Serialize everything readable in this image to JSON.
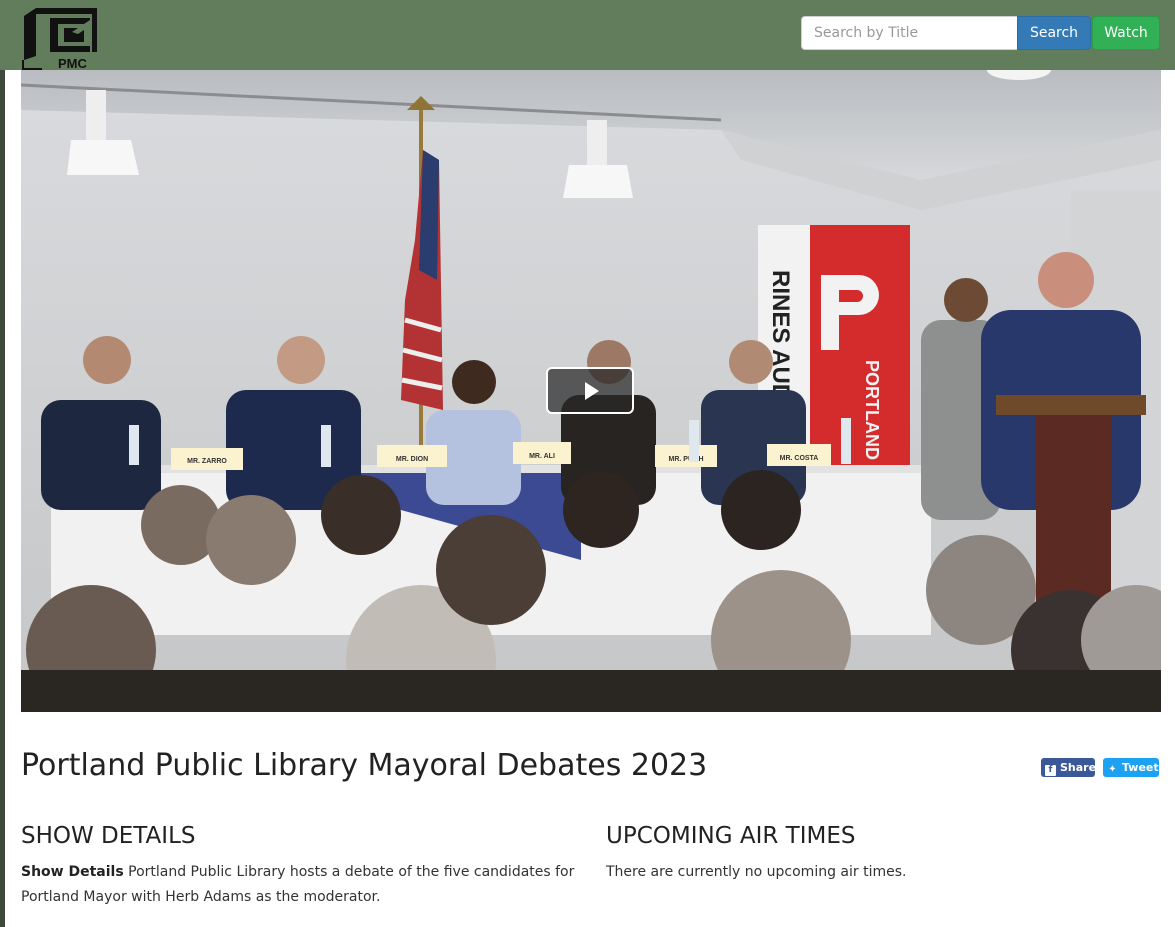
{
  "header": {
    "logo_text": "PMC",
    "search_placeholder": "Search by Title",
    "search_value": "",
    "search_button": "Search",
    "watch_button": "Watch"
  },
  "video": {
    "banner_vertical_text": "RINES AUD",
    "banner_library_text": "PORTLAND PUBLIC LIBRARY",
    "name_cards": [
      "MR. ZARRO",
      "MR. DION",
      "MR. ALI",
      "MR. PUGH",
      "MR. COSTA"
    ]
  },
  "show": {
    "title": "Portland Public Library Mayoral Debates 2023",
    "share_label": "Share",
    "tweet_label": "Tweet"
  },
  "details": {
    "heading": "SHOW DETAILS",
    "label": "Show Details",
    "description": "Portland Public Library hosts a debate of the five candidates for Portland Mayor with Herb Adams as the moderator."
  },
  "air_times": {
    "heading": "UPCOMING AIR TIMES",
    "message": "There are currently no upcoming air times."
  },
  "colors": {
    "header_bg": "#627d5b",
    "search_button": "#337ab7",
    "watch_button": "#31b055",
    "share_button": "#3b5998",
    "tweet_button": "#1da1f2"
  },
  "icons": {
    "logo": "pmc-logo",
    "play": "play-icon",
    "facebook": "facebook-icon",
    "twitter": "twitter-icon"
  }
}
